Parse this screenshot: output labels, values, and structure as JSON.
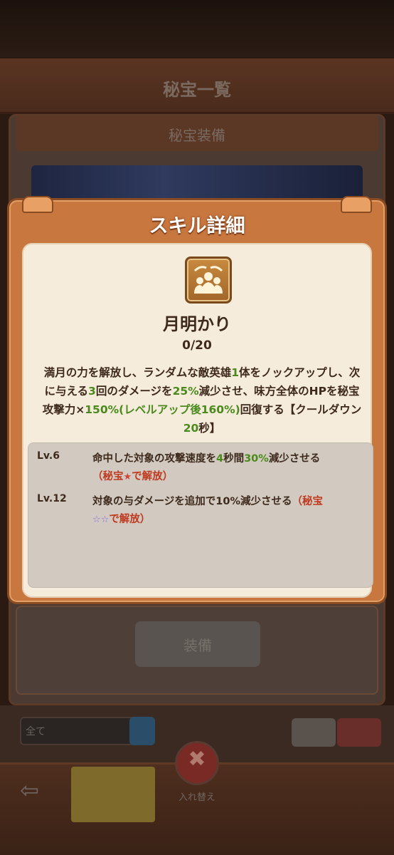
{
  "background": {
    "screen_title": "秘宝一覧",
    "sub_title": "秘宝装備",
    "grey_button_label": "装備",
    "input_text": "全て",
    "back_icon": "back-arrow-icon",
    "close_label": "入れ替え"
  },
  "dialog": {
    "title": "スキル詳細",
    "icon": "people-under-moonlight-icon",
    "skill_name": "月明かり",
    "level_progress": "0/20",
    "description": {
      "p1": "満月の力を解放し、ランダムな敵英雄",
      "n1": "1",
      "p2": "体をノックアップし、次に与える",
      "n2": "3",
      "p3": "回のダメージを",
      "n3": "25%",
      "p4": "減少させ、味方全体のHPを秘宝攻撃力×",
      "n4": "150%(レベルアップ後160%)",
      "p5": "回復する【クールダウン",
      "n5": "20",
      "p6": "秒】"
    },
    "upgrades": [
      {
        "level": "Lv.6",
        "t1": "命中した対象の攻撃速度を",
        "n1": "4",
        "t2": "秒間",
        "n2": "30%",
        "t3": "減少させる",
        "cond_pre": "（秘宝",
        "cond_post": "で解放）",
        "stars": [
          "★"
        ]
      },
      {
        "level": "Lv.12",
        "t1": "対象の与ダメージを追加で10%減少させる",
        "cond_pre": "（秘宝",
        "cond_post": "で解放）",
        "stars": [
          "☆",
          "☆"
        ]
      }
    ],
    "colors": {
      "frame": "#c8773f",
      "body": "#f6ecdc",
      "highlight": "#4a8a1c",
      "unlock_condition": "#c0391e"
    }
  }
}
